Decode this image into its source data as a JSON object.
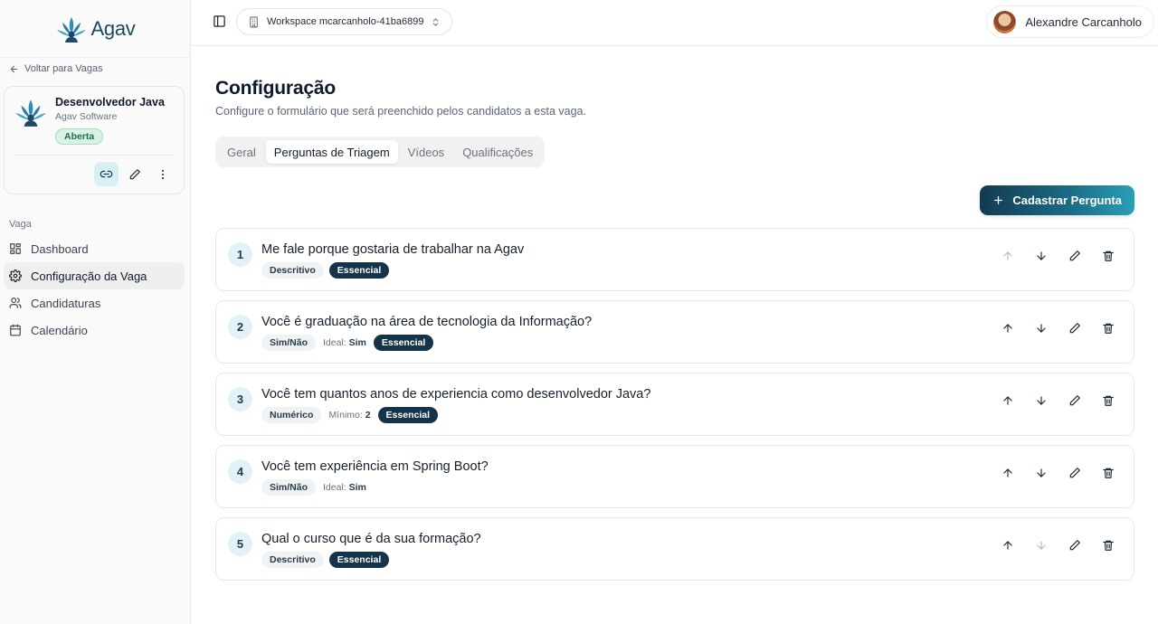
{
  "brand": {
    "name": "Agav"
  },
  "sidebar": {
    "back_label": "Voltar para Vagas",
    "job": {
      "title": "Desenvolvedor Java",
      "company": "Agav Software",
      "status": "Aberta"
    },
    "section_label": "Vaga",
    "items": [
      {
        "label": "Dashboard",
        "icon": "dashboard-icon"
      },
      {
        "label": "Configuração da Vaga",
        "icon": "gear-icon",
        "active": true
      },
      {
        "label": "Candidaturas",
        "icon": "users-icon"
      },
      {
        "label": "Calendário",
        "icon": "calendar-icon"
      }
    ]
  },
  "header": {
    "workspace": "Workspace mcarcanholo-41ba6899",
    "user_name": "Alexandre Carcanholo"
  },
  "main": {
    "title": "Configuração",
    "subtitle": "Configure o formulário que será preenchido pelos candidatos a esta vaga.",
    "tabs": [
      {
        "label": "Geral"
      },
      {
        "label": "Perguntas de Triagem",
        "active": true
      },
      {
        "label": "Vídeos"
      },
      {
        "label": "Qualificações"
      }
    ],
    "add_button": "Cadastrar Pergunta",
    "questions": [
      {
        "number": "1",
        "text": "Me fale porque gostaria de trabalhar na Agav",
        "type": "Descritivo",
        "meta_label": "",
        "meta_value": "",
        "essential": "Essencial"
      },
      {
        "number": "2",
        "text": "Você é graduação na área de tecnologia da Informação?",
        "type": "Sim/Não",
        "meta_label": "Ideal:",
        "meta_value": "Sim",
        "essential": "Essencial"
      },
      {
        "number": "3",
        "text": "Você tem quantos anos de experiencia como desenvolvedor Java?",
        "type": "Numérico",
        "meta_label": "Mínimo:",
        "meta_value": "2",
        "essential": "Essencial"
      },
      {
        "number": "4",
        "text": "Você tem experiência em Spring Boot?",
        "type": "Sim/Não",
        "meta_label": "Ideal:",
        "meta_value": "Sim",
        "essential": ""
      },
      {
        "number": "5",
        "text": "Qual o curso que é da sua formação?",
        "type": "Descritivo",
        "meta_label": "",
        "meta_value": "",
        "essential": "Essencial"
      }
    ]
  },
  "colors": {
    "accent": "#163449",
    "accent_light": "#e2f2f6",
    "status_green": "#1f6e52"
  }
}
